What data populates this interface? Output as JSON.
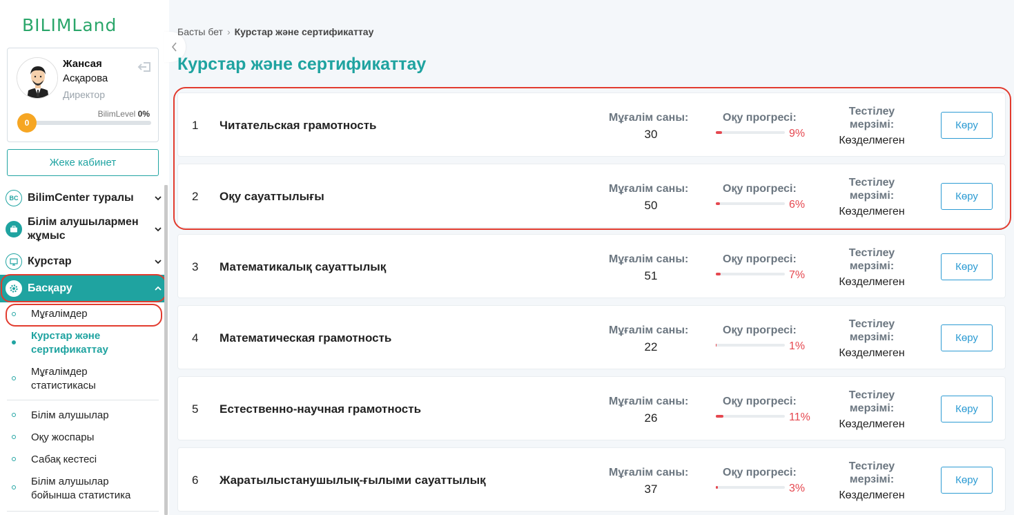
{
  "logo": "BILIMLand",
  "profile": {
    "first_name": "Жансая",
    "last_name": "Асқарова",
    "role": "Директор",
    "level_label": "BilimLevel",
    "level_percent": "0%",
    "level_badge": "0",
    "level_progress": 0
  },
  "cabinet_button": "Жеке кабинет",
  "nav": {
    "bilimcenter": {
      "label": "BilimCenter туралы",
      "icon": "BC"
    },
    "students_work": {
      "label": "Білім алушылармен жұмыс"
    },
    "courses": {
      "label": "Курстар"
    },
    "management": {
      "label": "Басқару"
    }
  },
  "subnav": {
    "teachers": "Мұғалімдер",
    "courses_cert": "Курстар және сертификаттау",
    "teacher_stats": "Мұғалімдер статистикасы",
    "students": "Білім алушылар",
    "study_plans": "Оқу жоспары",
    "schedule": "Сабақ кестесі",
    "student_stats": "Білім алушылар бойынша статистика"
  },
  "breadcrumb": {
    "home": "Басты бет",
    "current": "Курстар және сертификаттау"
  },
  "page_title": "Курстар және сертификаттау",
  "labels": {
    "teachers_count": "Мұғалім саны:",
    "progress": "Оқу прогресі:",
    "test_deadline": "Тестілеу мерзімі:",
    "view": "Көру"
  },
  "courses": [
    {
      "num": "1",
      "name": "Читательская грамотность",
      "teachers": "30",
      "progress": "9%",
      "progress_value": 9,
      "deadline": "Көзделмеген"
    },
    {
      "num": "2",
      "name": "Оқу сауаттылығы",
      "teachers": "50",
      "progress": "6%",
      "progress_value": 6,
      "deadline": "Көзделмеген"
    },
    {
      "num": "3",
      "name": "Математикалық сауаттылық",
      "teachers": "51",
      "progress": "7%",
      "progress_value": 7,
      "deadline": "Көзделмеген"
    },
    {
      "num": "4",
      "name": "Математическая грамотность",
      "teachers": "22",
      "progress": "1%",
      "progress_value": 1,
      "deadline": "Көзделмеген"
    },
    {
      "num": "5",
      "name": "Естественно-научная грамотность",
      "teachers": "26",
      "progress": "11%",
      "progress_value": 11,
      "deadline": "Көзделмеген"
    },
    {
      "num": "6",
      "name": "Жаратылыстанушылық-ғылыми сауаттылық",
      "teachers": "37",
      "progress": "3%",
      "progress_value": 3,
      "deadline": "Көзделмеген"
    }
  ],
  "colors": {
    "accent": "#1fa3a0",
    "progress": "#e5474f",
    "highlight": "#e23b2e",
    "button": "#2c9bd3"
  }
}
